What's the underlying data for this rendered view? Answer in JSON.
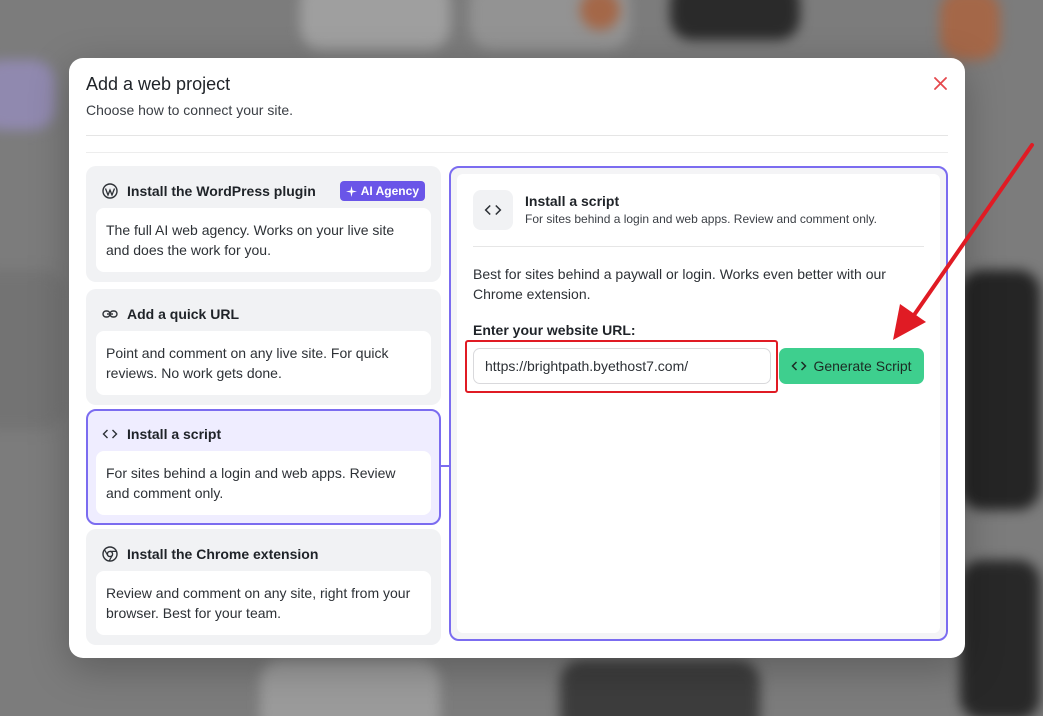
{
  "modal": {
    "title": "Add a web project",
    "subtitle": "Choose how to connect your site."
  },
  "options": [
    {
      "label": "Install the WordPress plugin",
      "icon": "wordpress-icon",
      "badge": "AI Agency",
      "description": "The full AI web agency. Works on your live site and does the work for you."
    },
    {
      "label": "Add a quick URL",
      "icon": "link-icon",
      "description": "Point and comment on any live site. For quick reviews. No work gets done."
    },
    {
      "label": "Install a script",
      "icon": "code-icon",
      "selected": true,
      "description": "For sites behind a login and web apps. Review and comment only."
    },
    {
      "label": "Install the Chrome extension",
      "icon": "chrome-icon",
      "description": "Review and comment on any site, right from your browser. Best for your team."
    }
  ],
  "panel": {
    "title": "Install a script",
    "subtitle": "For sites behind a login and web apps. Review and comment only.",
    "description": "Best for sites behind a paywall or login. Works even better with our Chrome extension.",
    "url_label": "Enter your website URL:",
    "url_value": "https://brightpath.byethost7.com/",
    "button_label": "Generate Script"
  },
  "colors": {
    "accent": "#7b6cf0",
    "badge": "#6a55e8",
    "button": "#3ecf8e",
    "annotation": "#e01b24",
    "close": "#e5484d"
  }
}
